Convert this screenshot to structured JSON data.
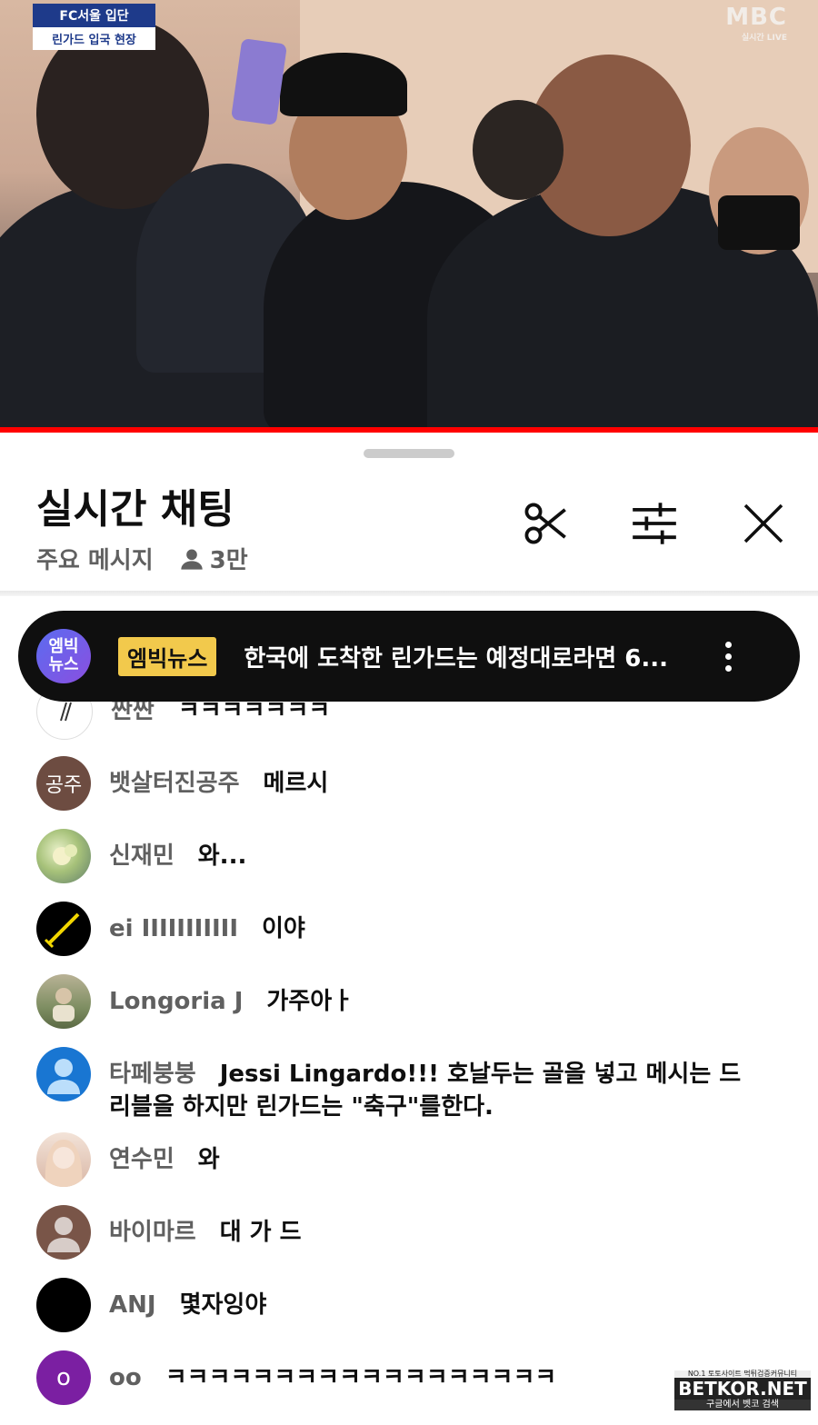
{
  "video": {
    "caption_top": "FC서울 입단",
    "caption_bottom": "린가드 입국 현장",
    "broadcaster": "MBC",
    "broadcaster_sub": "실시간 LIVE",
    "progress_color": "#ff0000"
  },
  "chat": {
    "title": "실시간 채팅",
    "mode": "주요 메시지",
    "viewer_count": "3만",
    "icons": [
      "scissors-icon",
      "filter-sliders-icon",
      "close-icon"
    ]
  },
  "pinned": {
    "avatar_text": "엠빅\n뉴스",
    "badge": "엠빅뉴스",
    "text": "한국에 도착한 린가드는 예정대로라면 6...",
    "badge_color": "#f2c94c"
  },
  "messages": [
    {
      "author": "짠짠",
      "text": "ㅋㅋㅋㅋㅋㅋㅋ",
      "avatar": "slash"
    },
    {
      "author": "뱃살터진공주",
      "text": "메르시",
      "avatar_text": "공주",
      "avatar_color": "#6d4c41"
    },
    {
      "author": "신재민",
      "text": "와...",
      "avatar": "flower"
    },
    {
      "author": "ei IIIIIIIIIII",
      "text": "이야",
      "avatar": "sword"
    },
    {
      "author": "Longoria J",
      "text": "가주아ㅏ",
      "avatar": "photo"
    },
    {
      "author": "타페붕붕",
      "text": "Jessi Lingardo!!! 호날두는 골을 넣고 메시는 드리블을 하지만 린가드는 \"축구\"를한다.",
      "avatar": "default-blue"
    },
    {
      "author": "연수민",
      "text": "와",
      "avatar": "portrait"
    },
    {
      "author": "바이마르",
      "text": "대 가 드",
      "avatar": "default-brown"
    },
    {
      "author": "ANJ",
      "text": "몇자잉야",
      "avatar": "black"
    },
    {
      "author": "oo",
      "text": "ㅋㅋㅋㅋㅋㅋㅋㅋㅋㅋㅋㅋㅋㅋㅋㅋㅋㅋ",
      "avatar_text": "o",
      "avatar_color": "#7b1fa2"
    }
  ],
  "watermark": {
    "top": "NO.1 토토사이트 먹튀검증커뮤니티",
    "main": "BETKOR.NET",
    "bottom": "구글에서 벳코 검색"
  }
}
